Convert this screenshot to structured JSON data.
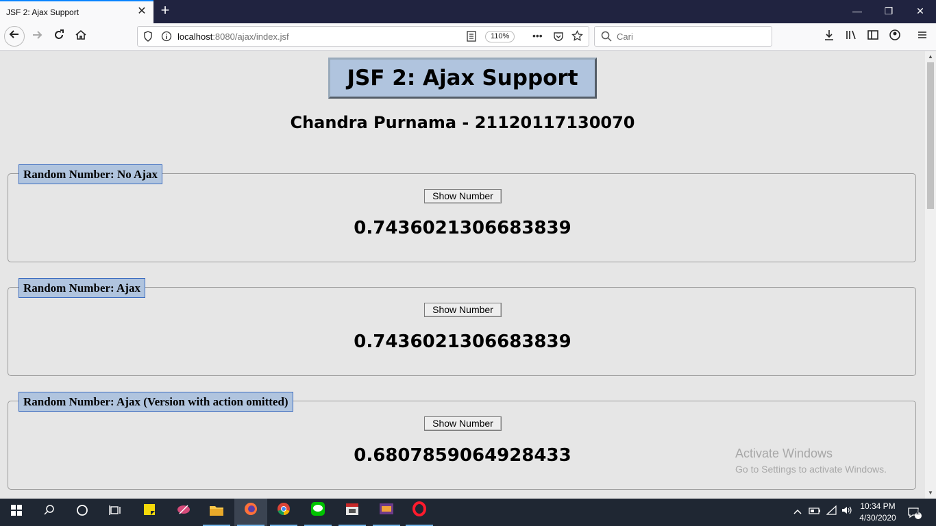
{
  "browser": {
    "tab_title": "JSF 2: Ajax Support",
    "tab_close": "✕",
    "new_tab": "+",
    "url_host": "localhost",
    "url_path": ":8080/ajax/index.jsf",
    "zoom": "110%",
    "search_placeholder": "Cari",
    "window_controls": {
      "minimize": "—",
      "restore": "❐",
      "close": "✕"
    }
  },
  "page": {
    "title": "JSF 2: Ajax Support",
    "subtitle": "Chandra Purnama - 21120117130070",
    "sections": [
      {
        "legend": "Random Number: No Ajax",
        "button": "Show Number",
        "number": "0.7436021306683839"
      },
      {
        "legend": "Random Number: Ajax",
        "button": "Show Number",
        "number": "0.7436021306683839"
      },
      {
        "legend": "Random Number: Ajax (Version with action omitted)",
        "button": "Show Number",
        "number": "0.6807859064928433"
      }
    ]
  },
  "watermark": {
    "line1": "Activate Windows",
    "line2": "Go to Settings to activate Windows."
  },
  "taskbar": {
    "time": "10:34 PM",
    "date": "4/30/2020",
    "notifications": "2"
  }
}
